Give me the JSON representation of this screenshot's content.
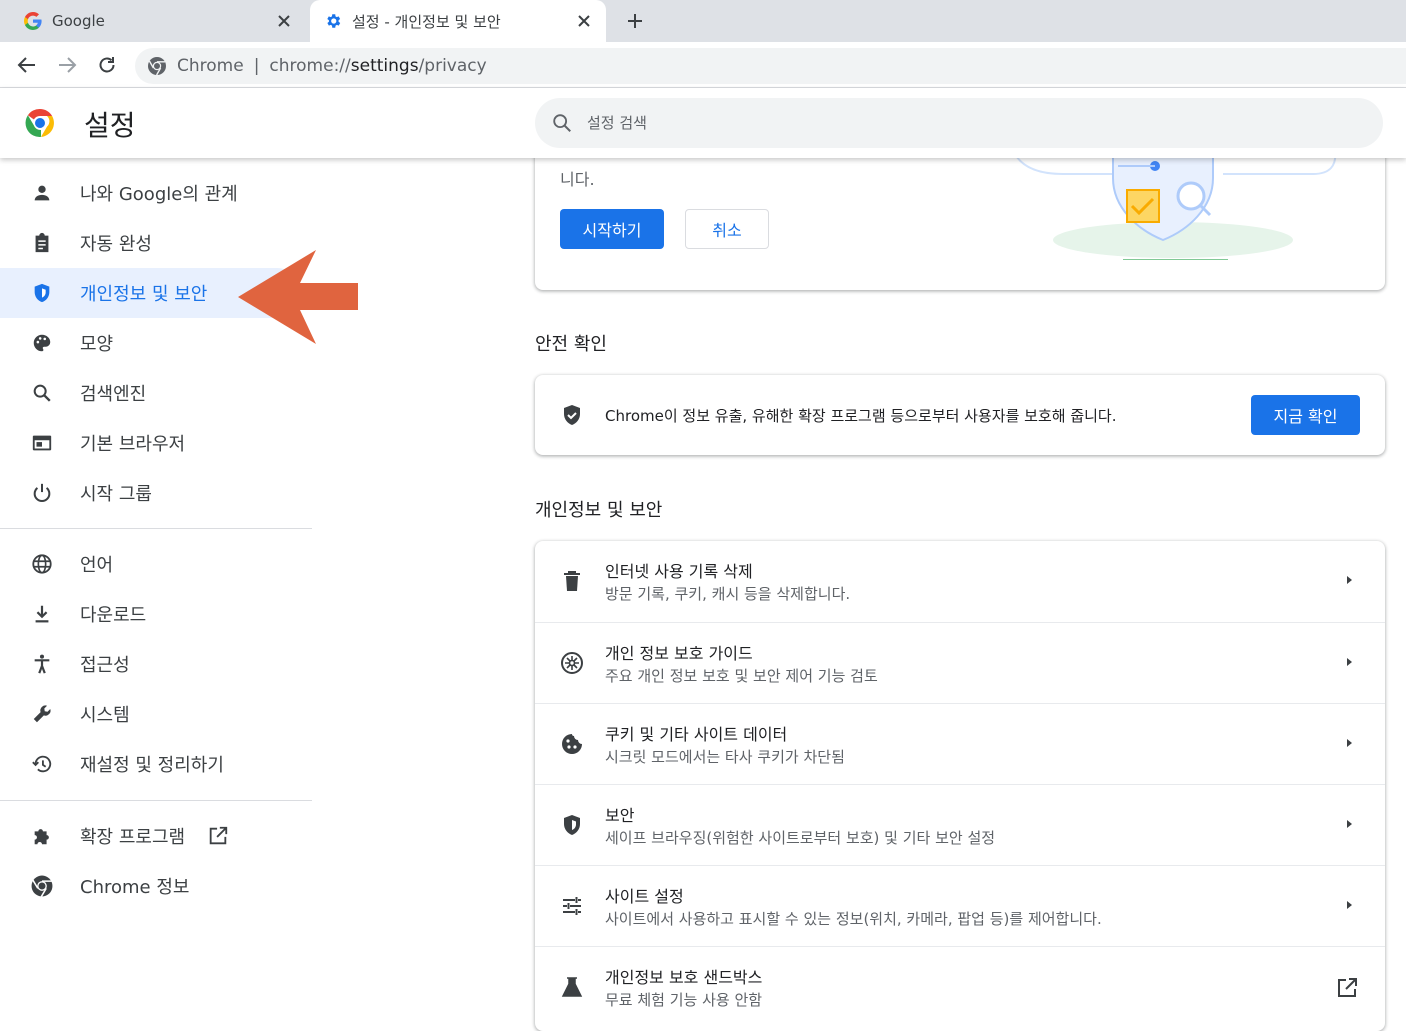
{
  "tabs": [
    {
      "title": "Google",
      "icon": "google-icon"
    },
    {
      "title": "설정 - 개인정보 및 보안",
      "icon": "gear-icon"
    }
  ],
  "omnibox": {
    "site_label": "Chrome",
    "separator": "|",
    "url_scheme": "chrome://",
    "url_host": "settings",
    "url_path": "/privacy"
  },
  "header": {
    "title": "설정",
    "search_placeholder": "설정 검색"
  },
  "sidebar": {
    "items": [
      {
        "label": "나와 Google의 관계",
        "icon": "person-icon"
      },
      {
        "label": "자동 완성",
        "icon": "clipboard-icon"
      },
      {
        "label": "개인정보 및 보안",
        "icon": "shield-icon",
        "active": true
      },
      {
        "label": "모양",
        "icon": "palette-icon"
      },
      {
        "label": "검색엔진",
        "icon": "search-icon"
      },
      {
        "label": "기본 브라우저",
        "icon": "browser-window-icon"
      },
      {
        "label": "시작 그룹",
        "icon": "power-icon"
      },
      {
        "label": "언어",
        "icon": "globe-icon"
      },
      {
        "label": "다운로드",
        "icon": "download-icon"
      },
      {
        "label": "접근성",
        "icon": "accessibility-icon"
      },
      {
        "label": "시스템",
        "icon": "wrench-icon"
      },
      {
        "label": "재설정 및 정리하기",
        "icon": "history-icon"
      },
      {
        "label": "확장 프로그램",
        "icon": "puzzle-icon",
        "external": true
      },
      {
        "label": "Chrome 정보",
        "icon": "chrome-icon"
      }
    ]
  },
  "promo": {
    "text_tail": "니다.",
    "start_label": "시작하기",
    "cancel_label": "취소"
  },
  "safety_check": {
    "section_title": "안전 확인",
    "description": "Chrome이 정보 유출, 유해한 확장 프로그램 등으로부터 사용자를 보호해 줍니다.",
    "button_label": "지금 확인"
  },
  "privacy": {
    "section_title": "개인정보 및 보안",
    "rows": [
      {
        "title": "인터넷 사용 기록 삭제",
        "subtitle": "방문 기록, 쿠키, 캐시 등을 삭제합니다.",
        "icon": "trash-icon"
      },
      {
        "title": "개인 정보 보호 가이드",
        "subtitle": "주요 개인 정보 보호 및 보안 제어 기능 검토",
        "icon": "compass-icon"
      },
      {
        "title": "쿠키 및 기타 사이트 데이터",
        "subtitle": "시크릿 모드에서는 타사 쿠키가 차단됨",
        "icon": "cookie-icon"
      },
      {
        "title": "보안",
        "subtitle": "세이프 브라우징(위험한 사이트로부터 보호) 및 기타 보안 설정",
        "icon": "shield-icon"
      },
      {
        "title": "사이트 설정",
        "subtitle": "사이트에서 사용하고 표시할 수 있는 정보(위치, 카메라, 팝업 등)를 제어합니다.",
        "icon": "tune-icon"
      },
      {
        "title": "개인정보 보호 샌드박스",
        "subtitle": "무료 체험 기능 사용 안함",
        "icon": "flask-icon",
        "external": true
      }
    ]
  },
  "colors": {
    "accent": "#1a73e8",
    "active_bg": "#e8f0fe",
    "annotation_arrow": "#e0643f"
  }
}
